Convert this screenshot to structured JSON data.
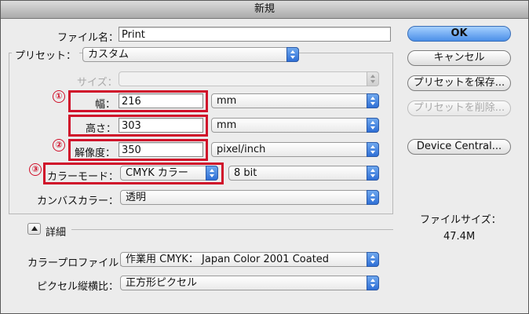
{
  "window": {
    "title": "新規"
  },
  "name": {
    "label": "ファイル名：",
    "value": "Print"
  },
  "preset": {
    "label": "プリセット：",
    "value": "カスタム"
  },
  "size": {
    "label": "サイズ：",
    "value": ""
  },
  "width": {
    "label": "幅：",
    "value": "216",
    "unit": "mm",
    "marker": "①"
  },
  "height": {
    "label": "高さ：",
    "value": "303",
    "unit": "mm"
  },
  "resolution": {
    "label": "解像度：",
    "value": "350",
    "unit": "pixel/inch",
    "marker": "②"
  },
  "color_mode": {
    "label": "カラーモード：",
    "value": "CMYK カラー",
    "depth": "8 bit",
    "marker": "③"
  },
  "background": {
    "label": "カンバスカラー：",
    "value": "透明"
  },
  "advanced": {
    "label": "詳細"
  },
  "color_profile": {
    "label": "カラープロファイル：",
    "value": "作業用 CMYK： Japan Color 2001 Coated"
  },
  "pixel_aspect": {
    "label": "ピクセル縦横比：",
    "value": "正方形ピクセル"
  },
  "buttons": {
    "ok": "OK",
    "cancel": "キャンセル",
    "save_preset": "プリセットを保存...",
    "delete_preset": "プリセットを削除...",
    "device_central": "Device Central..."
  },
  "file_size": {
    "label": "ファイルサイズ：",
    "value": "47.4M"
  },
  "colors": {
    "highlight": "#d0102a",
    "accent": "#4b8fe8"
  }
}
